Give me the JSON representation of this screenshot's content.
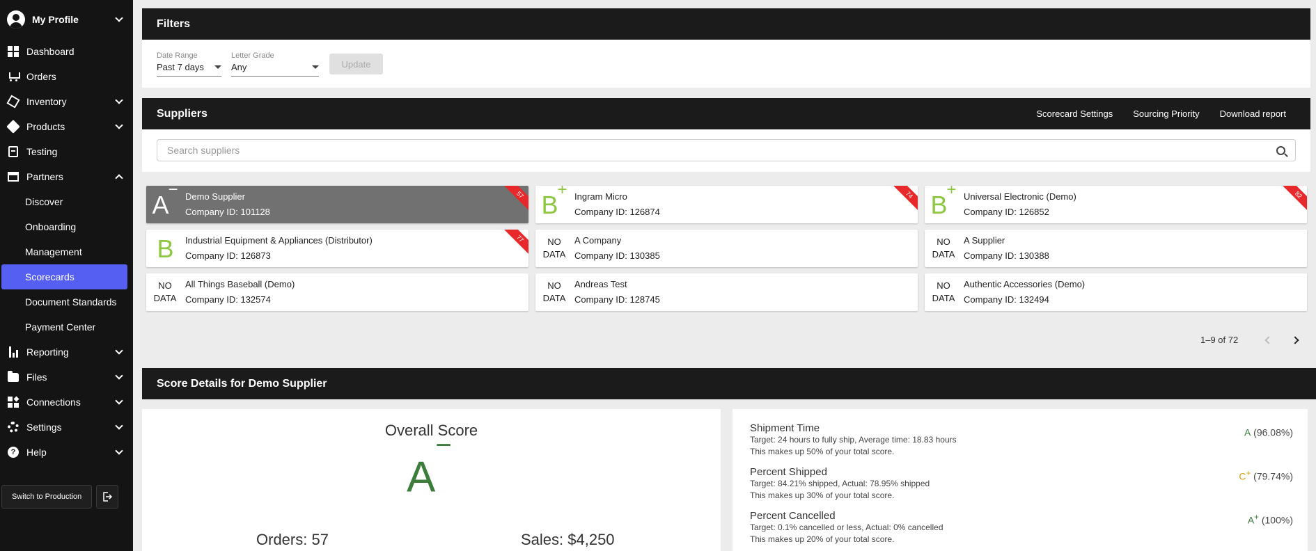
{
  "sidebar": {
    "profile_name": "My Profile",
    "items": [
      {
        "label": "Dashboard"
      },
      {
        "label": "Orders"
      },
      {
        "label": "Inventory"
      },
      {
        "label": "Products"
      },
      {
        "label": "Testing"
      },
      {
        "label": "Partners"
      },
      {
        "label": "Discover"
      },
      {
        "label": "Onboarding"
      },
      {
        "label": "Management"
      },
      {
        "label": "Scorecards"
      },
      {
        "label": "Document Standards"
      },
      {
        "label": "Payment Center"
      },
      {
        "label": "Reporting"
      },
      {
        "label": "Files"
      },
      {
        "label": "Connections"
      },
      {
        "label": "Settings"
      },
      {
        "label": "Help"
      }
    ],
    "switch_label": "Switch to Production"
  },
  "filters": {
    "title": "Filters",
    "date_range_label": "Date Range",
    "date_range_value": "Past 7 days",
    "letter_grade_label": "Letter Grade",
    "letter_grade_value": "Any",
    "update_label": "Update"
  },
  "suppliers": {
    "title": "Suppliers",
    "links": [
      "Scorecard Settings",
      "Sourcing Priority",
      "Download report"
    ],
    "search_placeholder": "Search suppliers",
    "cards": [
      {
        "grade": "A",
        "mod": "−",
        "name": "Demo Supplier",
        "company": "Company ID: 101128",
        "badge": "57",
        "selected": true
      },
      {
        "grade": "B",
        "mod": "+",
        "name": "Ingram Micro",
        "company": "Company ID: 126874",
        "badge": "74"
      },
      {
        "grade": "B",
        "mod": "+",
        "name": "Universal Electronic (Demo)",
        "company": "Company ID: 126852",
        "badge": "82"
      },
      {
        "grade": "B",
        "mod": "",
        "name": "Industrial Equipment & Appliances (Distributor)",
        "company": "Company ID: 126873",
        "badge": "77"
      },
      {
        "nodata1": "NO",
        "nodata2": "DATA",
        "name": "A Company",
        "company": "Company ID: 130385"
      },
      {
        "nodata1": "NO",
        "nodata2": "DATA",
        "name": "A Supplier",
        "company": "Company ID: 130388"
      },
      {
        "nodata1": "NO",
        "nodata2": "DATA",
        "name": "All Things Baseball (Demo)",
        "company": "Company ID: 132574"
      },
      {
        "nodata1": "NO",
        "nodata2": "DATA",
        "name": "Andreas Test",
        "company": "Company ID: 128745"
      },
      {
        "nodata1": "NO",
        "nodata2": "DATA",
        "name": "Authentic Accessories (Demo)",
        "company": "Company ID: 132494"
      }
    ],
    "pagination": "1–9 of 72"
  },
  "score_details": {
    "title": "Score Details for Demo Supplier",
    "overall_label": "Overall Score",
    "grade": "A",
    "grade_mod": "−",
    "orders": "Orders: 57",
    "sales": "Sales: $4,250",
    "metrics": [
      {
        "title": "Shipment Time",
        "line1": "Target: 24 hours to fully ship, Average time: 18.83 hours",
        "line2": "This makes up 50% of your total score.",
        "grade": "A",
        "grade_mod": "",
        "pct": " (96.08%)"
      },
      {
        "title": "Percent Shipped",
        "line1": "Target: 84.21% shipped, Actual: 78.95% shipped",
        "line2": "This makes up 30% of your total score.",
        "grade": "C",
        "grade_mod": "+",
        "pct": " (79.74%)"
      },
      {
        "title": "Percent Cancelled",
        "line1": "Target: 0.1% cancelled or less, Actual: 0% cancelled",
        "line2": "This makes up 20% of your total score.",
        "grade": "A",
        "grade_mod": "+",
        "pct": " (100%)"
      }
    ]
  },
  "colors": {
    "accent": "#5560f3",
    "grade_green": "#8dc63f",
    "dark_green": "#3c7d3c",
    "ribbon": "#e8292b"
  }
}
